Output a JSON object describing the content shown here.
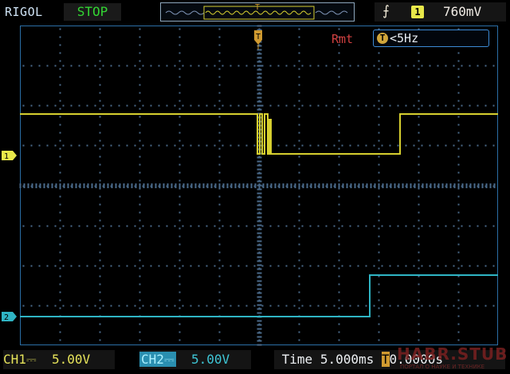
{
  "header": {
    "brand": "RIGOL",
    "run_status": "STOP",
    "trigger_edge_icon": "rising-edge-icon",
    "trigger_source": "1",
    "trigger_level": "760mV"
  },
  "overlay": {
    "trigger_mode": "Rmt",
    "frequency": "<5Hz"
  },
  "channels": [
    {
      "name": "CH1",
      "coupling_icon": "dc-coupling-icon",
      "scale": "5.00V",
      "color": "#d6cf2f",
      "marker": "1"
    },
    {
      "name": "CH2",
      "coupling_icon": "dc-coupling-icon",
      "scale": "5.00V",
      "color": "#2fb4c4",
      "marker": "2"
    }
  ],
  "timebase": {
    "label": "Time",
    "scale": "5.000ms",
    "offset": "0.0000s"
  },
  "watermark": {
    "text": "HABR.STUB",
    "sub": "ПОРТАЛ О НАУКЕ И ТЕХНИКЕ"
  },
  "colors": {
    "grid": "#4a6a8a",
    "frame": "#2b6ea6",
    "ch1": "#d6cf2f",
    "ch2": "#2fb4c4",
    "trigger_marker": "#d09a30"
  }
}
